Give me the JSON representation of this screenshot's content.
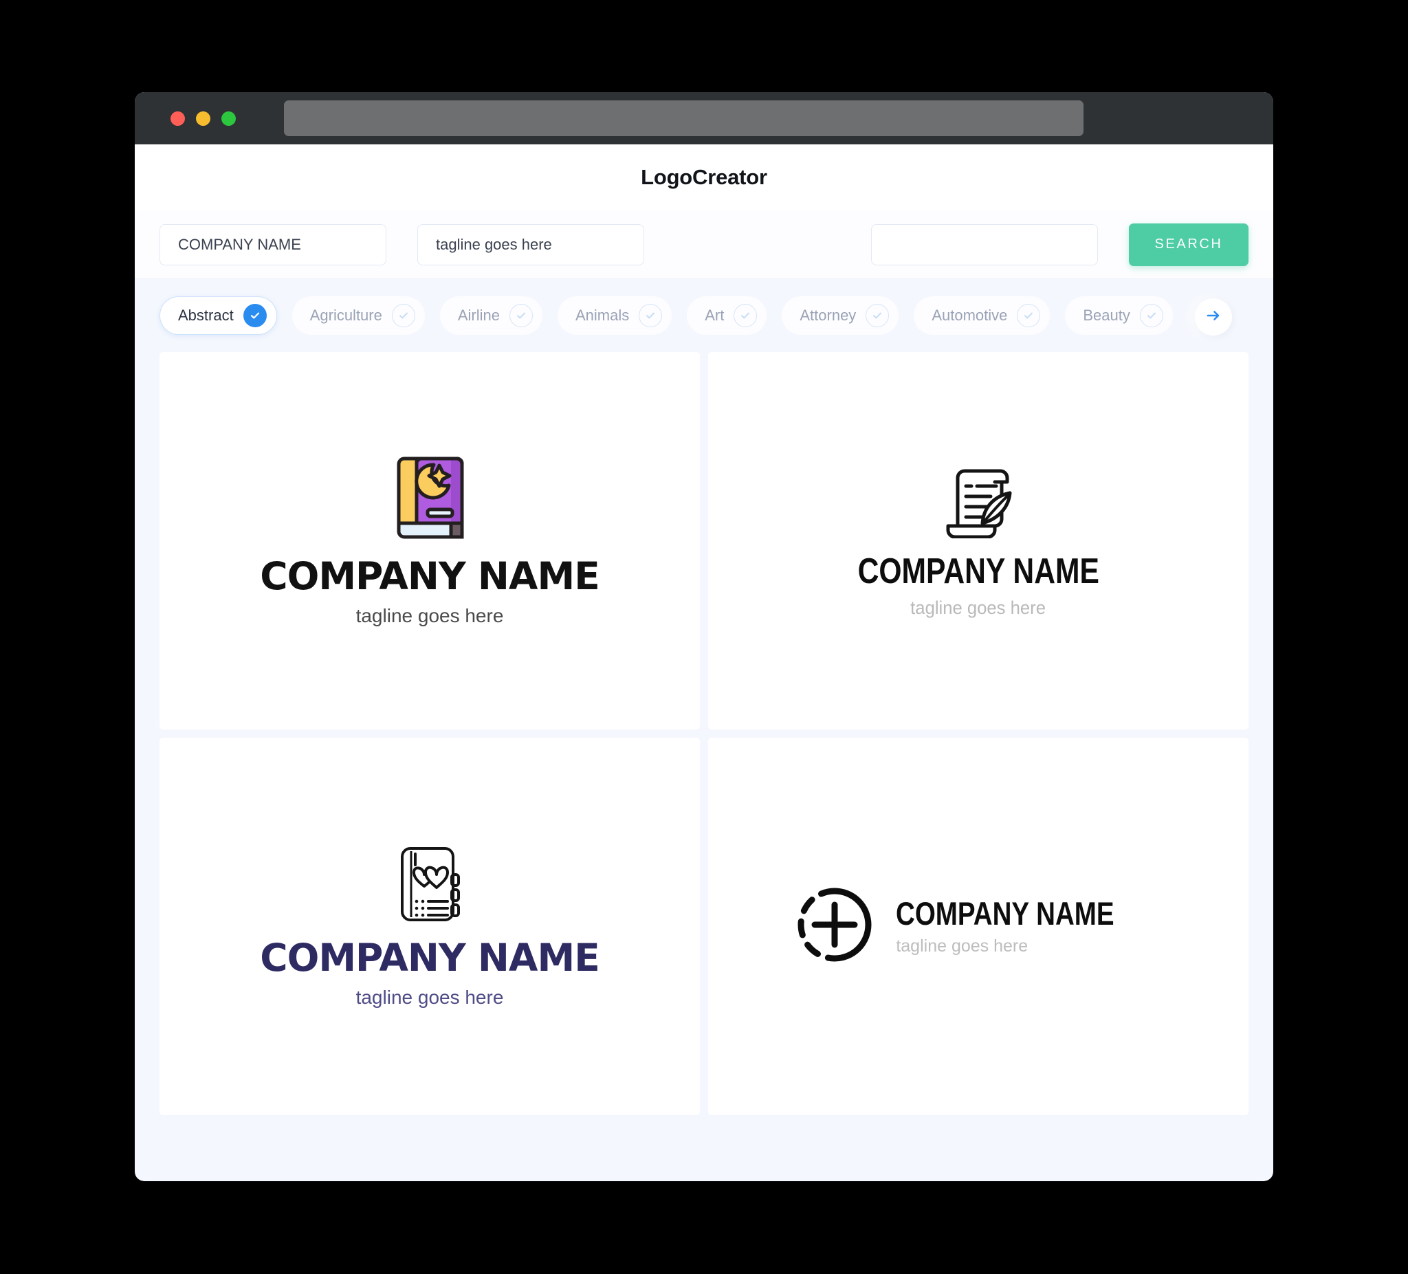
{
  "window": {
    "traffic_lights": [
      "close",
      "minimize",
      "maximize"
    ],
    "url_value": ""
  },
  "header": {
    "title": "LogoCreator"
  },
  "search": {
    "company_value": "COMPANY NAME",
    "company_placeholder": "COMPANY NAME",
    "tagline_value": "tagline goes here",
    "tagline_placeholder": "tagline goes here",
    "extra_value": "",
    "extra_placeholder": "",
    "button_label": "SEARCH",
    "button_color": "#4ecca3"
  },
  "categories": {
    "items": [
      {
        "label": "Abstract",
        "selected": true
      },
      {
        "label": "Agriculture",
        "selected": false
      },
      {
        "label": "Airline",
        "selected": false
      },
      {
        "label": "Animals",
        "selected": false
      },
      {
        "label": "Art",
        "selected": false
      },
      {
        "label": "Attorney",
        "selected": false
      },
      {
        "label": "Automotive",
        "selected": false
      },
      {
        "label": "Beauty",
        "selected": false
      }
    ],
    "next_arrow": "→",
    "active_color": "#2b8cf0"
  },
  "results": {
    "cards": [
      {
        "icon": "book-crescent-star-icon",
        "name": "COMPANY NAME",
        "tagline": "tagline goes here",
        "name_color": "#111111",
        "tagline_color": "#4a4a4a",
        "layout": "stacked"
      },
      {
        "icon": "scroll-quill-icon",
        "name": "COMPANY NAME",
        "tagline": "tagline goes here",
        "name_color": "#0d0d0d",
        "tagline_color": "#b9b9b9",
        "layout": "stacked"
      },
      {
        "icon": "notebook-hearts-icon",
        "name": "COMPANY NAME",
        "tagline": "tagline goes here",
        "name_color": "#2e2b63",
        "tagline_color": "#4f4c86",
        "layout": "stacked"
      },
      {
        "icon": "dashed-circle-plus-icon",
        "name": "COMPANY NAME",
        "tagline": "tagline goes here",
        "name_color": "#0d0d0d",
        "tagline_color": "#bdbdbd",
        "layout": "horizontal"
      }
    ]
  }
}
